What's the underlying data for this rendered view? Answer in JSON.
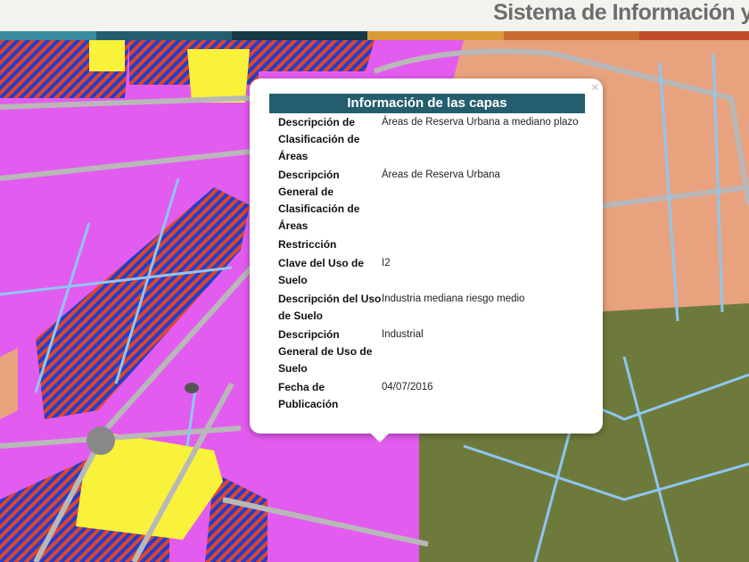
{
  "header": {
    "title": "Sistema de Información y"
  },
  "colors": {
    "bar": [
      "#3a8aa0",
      "#245e6e",
      "#173a44",
      "#d99c35",
      "#c86a32",
      "#c04a2c"
    ],
    "magenta": "#e35cf0",
    "peach": "#e9a27e",
    "olive": "#6e7a3c",
    "yellow": "#f9f23a"
  },
  "popup": {
    "title": "Información de las capas",
    "close": "×",
    "rows": [
      {
        "label": "Descripción de Clasificación de Áreas",
        "value": "Áreas de Reserva Urbana a mediano plazo"
      },
      {
        "label": "Descripción General de Clasificación de Áreas",
        "value": "Áreas de Reserva Urbana"
      },
      {
        "label": "Restricción",
        "value": ""
      },
      {
        "label": "Clave del Uso de Suelo",
        "value": "I2"
      },
      {
        "label": "Descripción del Uso de Suelo",
        "value": "Industria mediana riesgo medio"
      },
      {
        "label": "Descripción General de Uso de Suelo",
        "value": "Industrial"
      },
      {
        "label": "Fecha de Publicación",
        "value": "04/07/2016"
      }
    ]
  }
}
